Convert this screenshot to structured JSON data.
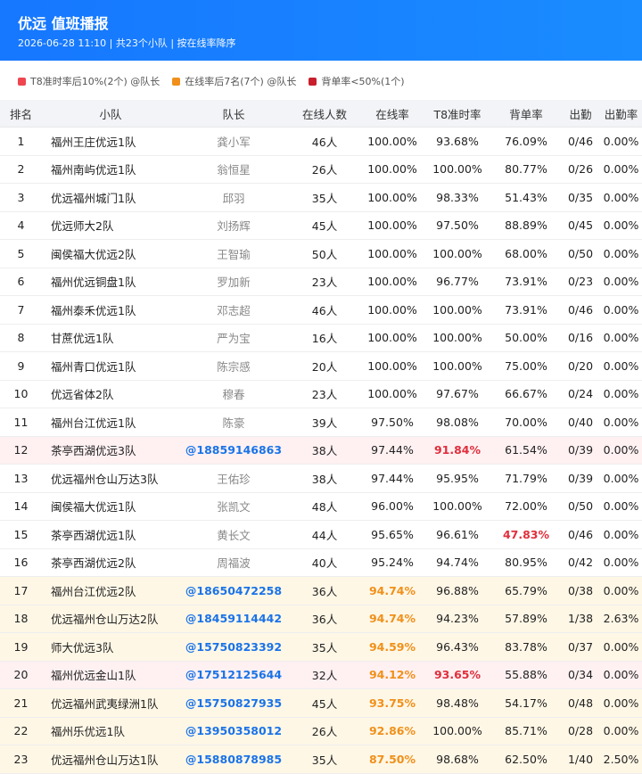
{
  "header": {
    "title": "优远 值班播报",
    "subtitle": "2026-06-28 11:10 | 共23个小队 | 按在线率降序"
  },
  "legend": [
    {
      "color": "#ef4650",
      "label": "T8准时率后10%(2个) @队长"
    },
    {
      "color": "#f0901a",
      "label": "在线率后7名(7个) @队长"
    },
    {
      "color": "#c81e2d",
      "label": "背单率<50%(1个)"
    }
  ],
  "columns": [
    "排名",
    "小队",
    "队长",
    "在线人数",
    "在线率",
    "T8准时率",
    "背单率",
    "出勤",
    "出勤率"
  ],
  "rows": [
    {
      "rank": "1",
      "team": "福州王庄优远1队",
      "leader": "龚小军",
      "online_count": "46人",
      "online_rate": "100.00%",
      "t8_rate": "93.68%",
      "back_rate": "76.09%",
      "attendance": "0/46",
      "attendance_rate": "0.00%",
      "row_class": "",
      "leader_phone": false,
      "online_hl": "",
      "t8_hl": "",
      "back_hl": ""
    },
    {
      "rank": "2",
      "team": "福州南屿优远1队",
      "leader": "翁恒星",
      "online_count": "26人",
      "online_rate": "100.00%",
      "t8_rate": "100.00%",
      "back_rate": "80.77%",
      "attendance": "0/26",
      "attendance_rate": "0.00%",
      "row_class": "",
      "leader_phone": false,
      "online_hl": "",
      "t8_hl": "",
      "back_hl": ""
    },
    {
      "rank": "3",
      "team": "优远福州城门1队",
      "leader": "邱羽",
      "online_count": "35人",
      "online_rate": "100.00%",
      "t8_rate": "98.33%",
      "back_rate": "51.43%",
      "attendance": "0/35",
      "attendance_rate": "0.00%",
      "row_class": "",
      "leader_phone": false,
      "online_hl": "",
      "t8_hl": "",
      "back_hl": ""
    },
    {
      "rank": "4",
      "team": "优远师大2队",
      "leader": "刘扬辉",
      "online_count": "45人",
      "online_rate": "100.00%",
      "t8_rate": "97.50%",
      "back_rate": "88.89%",
      "attendance": "0/45",
      "attendance_rate": "0.00%",
      "row_class": "",
      "leader_phone": false,
      "online_hl": "",
      "t8_hl": "",
      "back_hl": ""
    },
    {
      "rank": "5",
      "team": "闽侯福大优远2队",
      "leader": "王智瑜",
      "online_count": "50人",
      "online_rate": "100.00%",
      "t8_rate": "100.00%",
      "back_rate": "68.00%",
      "attendance": "0/50",
      "attendance_rate": "0.00%",
      "row_class": "",
      "leader_phone": false,
      "online_hl": "",
      "t8_hl": "",
      "back_hl": ""
    },
    {
      "rank": "6",
      "team": "福州优远铜盘1队",
      "leader": "罗加新",
      "online_count": "23人",
      "online_rate": "100.00%",
      "t8_rate": "96.77%",
      "back_rate": "73.91%",
      "attendance": "0/23",
      "attendance_rate": "0.00%",
      "row_class": "",
      "leader_phone": false,
      "online_hl": "",
      "t8_hl": "",
      "back_hl": ""
    },
    {
      "rank": "7",
      "team": "福州泰禾优远1队",
      "leader": "邓志超",
      "online_count": "46人",
      "online_rate": "100.00%",
      "t8_rate": "100.00%",
      "back_rate": "73.91%",
      "attendance": "0/46",
      "attendance_rate": "0.00%",
      "row_class": "",
      "leader_phone": false,
      "online_hl": "",
      "t8_hl": "",
      "back_hl": ""
    },
    {
      "rank": "8",
      "team": "甘蔗优远1队",
      "leader": "严为宝",
      "online_count": "16人",
      "online_rate": "100.00%",
      "t8_rate": "100.00%",
      "back_rate": "50.00%",
      "attendance": "0/16",
      "attendance_rate": "0.00%",
      "row_class": "",
      "leader_phone": false,
      "online_hl": "",
      "t8_hl": "",
      "back_hl": ""
    },
    {
      "rank": "9",
      "team": "福州青口优远1队",
      "leader": "陈宗感",
      "online_count": "20人",
      "online_rate": "100.00%",
      "t8_rate": "100.00%",
      "back_rate": "75.00%",
      "attendance": "0/20",
      "attendance_rate": "0.00%",
      "row_class": "",
      "leader_phone": false,
      "online_hl": "",
      "t8_hl": "",
      "back_hl": ""
    },
    {
      "rank": "10",
      "team": "优远省体2队",
      "leader": "穆春",
      "online_count": "23人",
      "online_rate": "100.00%",
      "t8_rate": "97.67%",
      "back_rate": "66.67%",
      "attendance": "0/24",
      "attendance_rate": "0.00%",
      "row_class": "",
      "leader_phone": false,
      "online_hl": "",
      "t8_hl": "",
      "back_hl": ""
    },
    {
      "rank": "11",
      "team": "福州台江优远1队",
      "leader": "陈豪",
      "online_count": "39人",
      "online_rate": "97.50%",
      "t8_rate": "98.08%",
      "back_rate": "70.00%",
      "attendance": "0/40",
      "attendance_rate": "0.00%",
      "row_class": "",
      "leader_phone": false,
      "online_hl": "",
      "t8_hl": "",
      "back_hl": ""
    },
    {
      "rank": "12",
      "team": "茶亭西湖优远3队",
      "leader": "@18859146863",
      "online_count": "38人",
      "online_rate": "97.44%",
      "t8_rate": "91.84%",
      "back_rate": "61.54%",
      "attendance": "0/39",
      "attendance_rate": "0.00%",
      "row_class": "row-red",
      "leader_phone": true,
      "online_hl": "",
      "t8_hl": "c-red",
      "back_hl": ""
    },
    {
      "rank": "13",
      "team": "优远福州仓山万达3队",
      "leader": "王佑珍",
      "online_count": "38人",
      "online_rate": "97.44%",
      "t8_rate": "95.95%",
      "back_rate": "71.79%",
      "attendance": "0/39",
      "attendance_rate": "0.00%",
      "row_class": "",
      "leader_phone": false,
      "online_hl": "",
      "t8_hl": "",
      "back_hl": ""
    },
    {
      "rank": "14",
      "team": "闽侯福大优远1队",
      "leader": "张凯文",
      "online_count": "48人",
      "online_rate": "96.00%",
      "t8_rate": "100.00%",
      "back_rate": "72.00%",
      "attendance": "0/50",
      "attendance_rate": "0.00%",
      "row_class": "",
      "leader_phone": false,
      "online_hl": "",
      "t8_hl": "",
      "back_hl": ""
    },
    {
      "rank": "15",
      "team": "茶亭西湖优远1队",
      "leader": "黄长文",
      "online_count": "44人",
      "online_rate": "95.65%",
      "t8_rate": "96.61%",
      "back_rate": "47.83%",
      "attendance": "0/46",
      "attendance_rate": "0.00%",
      "row_class": "",
      "leader_phone": false,
      "online_hl": "",
      "t8_hl": "",
      "back_hl": "c-red"
    },
    {
      "rank": "16",
      "team": "茶亭西湖优远2队",
      "leader": "周福波",
      "online_count": "40人",
      "online_rate": "95.24%",
      "t8_rate": "94.74%",
      "back_rate": "80.95%",
      "attendance": "0/42",
      "attendance_rate": "0.00%",
      "row_class": "",
      "leader_phone": false,
      "online_hl": "",
      "t8_hl": "",
      "back_hl": ""
    },
    {
      "rank": "17",
      "team": "福州台江优远2队",
      "leader": "@18650472258",
      "online_count": "36人",
      "online_rate": "94.74%",
      "t8_rate": "96.88%",
      "back_rate": "65.79%",
      "attendance": "0/38",
      "attendance_rate": "0.00%",
      "row_class": "row-orange",
      "leader_phone": true,
      "online_hl": "c-orange",
      "t8_hl": "",
      "back_hl": ""
    },
    {
      "rank": "18",
      "team": "优远福州仓山万达2队",
      "leader": "@18459114442",
      "online_count": "36人",
      "online_rate": "94.74%",
      "t8_rate": "94.23%",
      "back_rate": "57.89%",
      "attendance": "1/38",
      "attendance_rate": "2.63%",
      "row_class": "row-orange",
      "leader_phone": true,
      "online_hl": "c-orange",
      "t8_hl": "",
      "back_hl": ""
    },
    {
      "rank": "19",
      "team": "师大优远3队",
      "leader": "@15750823392",
      "online_count": "35人",
      "online_rate": "94.59%",
      "t8_rate": "96.43%",
      "back_rate": "83.78%",
      "attendance": "0/37",
      "attendance_rate": "0.00%",
      "row_class": "row-orange",
      "leader_phone": true,
      "online_hl": "c-orange",
      "t8_hl": "",
      "back_hl": ""
    },
    {
      "rank": "20",
      "team": "福州优远金山1队",
      "leader": "@17512125644",
      "online_count": "32人",
      "online_rate": "94.12%",
      "t8_rate": "93.65%",
      "back_rate": "55.88%",
      "attendance": "0/34",
      "attendance_rate": "0.00%",
      "row_class": "row-red",
      "leader_phone": true,
      "online_hl": "c-orange",
      "t8_hl": "c-red",
      "back_hl": ""
    },
    {
      "rank": "21",
      "team": "优远福州武夷绿洲1队",
      "leader": "@15750827935",
      "online_count": "45人",
      "online_rate": "93.75%",
      "t8_rate": "98.48%",
      "back_rate": "54.17%",
      "attendance": "0/48",
      "attendance_rate": "0.00%",
      "row_class": "row-orange",
      "leader_phone": true,
      "online_hl": "c-orange",
      "t8_hl": "",
      "back_hl": ""
    },
    {
      "rank": "22",
      "team": "福州乐优远1队",
      "leader": "@13950358012",
      "online_count": "26人",
      "online_rate": "92.86%",
      "t8_rate": "100.00%",
      "back_rate": "85.71%",
      "attendance": "0/28",
      "attendance_rate": "0.00%",
      "row_class": "row-orange",
      "leader_phone": true,
      "online_hl": "c-orange",
      "t8_hl": "",
      "back_hl": ""
    },
    {
      "rank": "23",
      "team": "优远福州仓山万达1队",
      "leader": "@15880878985",
      "online_count": "35人",
      "online_rate": "87.50%",
      "t8_rate": "98.68%",
      "back_rate": "62.50%",
      "attendance": "1/40",
      "attendance_rate": "2.50%",
      "row_class": "row-orange",
      "leader_phone": true,
      "online_hl": "c-orange",
      "t8_hl": "",
      "back_hl": ""
    }
  ]
}
